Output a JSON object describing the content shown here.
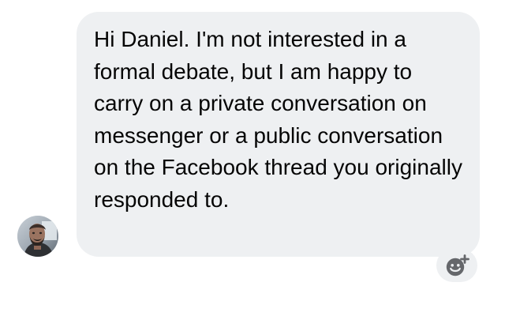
{
  "message": {
    "text": "Hi Daniel. I'm not interested in a formal debate, but I am happy to carry on a private conversation on messenger or a public conversation on the Facebook thread you originally responded to.",
    "bubble_color": "#eef0f2",
    "text_color": "#050505"
  },
  "sender": {
    "avatar_icon": "person-avatar"
  },
  "reaction": {
    "icon": "add-reaction-icon",
    "icon_color": "#65676b"
  }
}
